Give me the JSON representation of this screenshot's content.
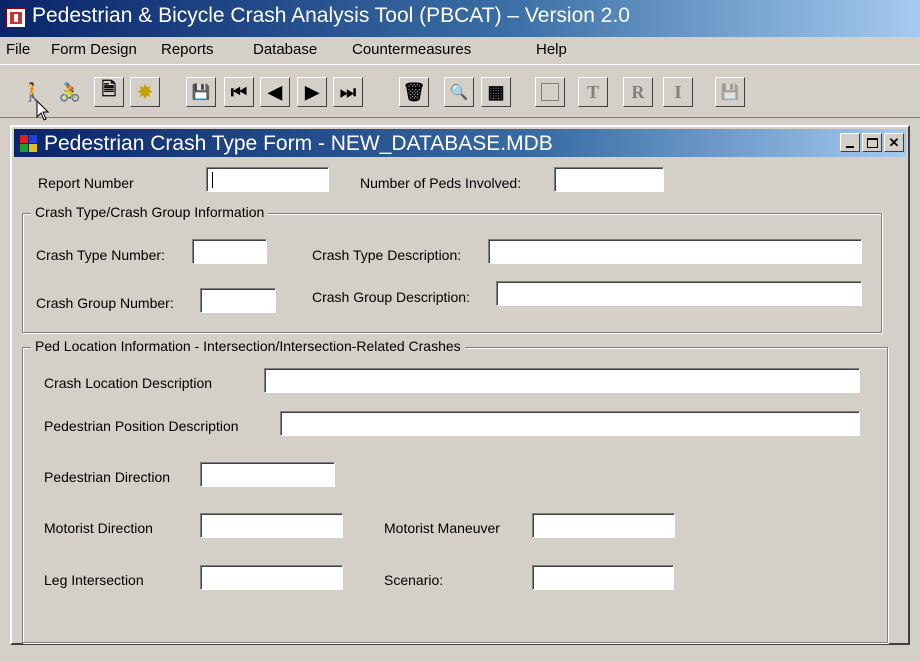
{
  "app": {
    "title": "Pedestrian & Bicycle Crash Analysis Tool (PBCAT) – Version 2.0"
  },
  "menu": [
    "File",
    "Form Design",
    "Reports",
    "Database",
    "Countermeasures",
    "Help"
  ],
  "toolbar": [
    {
      "name": "pedestrian-icon",
      "glyph": "🚶",
      "enabled": true
    },
    {
      "name": "bicycle-icon",
      "glyph": "🚴",
      "enabled": true
    },
    {
      "name": "properties-icon",
      "glyph": "🗎",
      "enabled": true
    },
    {
      "name": "new-record-icon",
      "glyph": "✸",
      "enabled": true
    },
    {
      "name": "save-icon",
      "glyph": "💾",
      "enabled": true
    },
    {
      "name": "first-record-icon",
      "glyph": "⏮",
      "enabled": true
    },
    {
      "name": "previous-record-icon",
      "glyph": "◀",
      "enabled": true
    },
    {
      "name": "next-record-icon",
      "glyph": "▶",
      "enabled": true
    },
    {
      "name": "last-record-icon",
      "glyph": "⏭",
      "enabled": true
    },
    {
      "name": "delete-icon",
      "glyph": "🗑",
      "enabled": true
    },
    {
      "name": "search-icon",
      "glyph": "🔍",
      "enabled": true
    },
    {
      "name": "calculator-icon",
      "glyph": "▦",
      "enabled": true
    },
    {
      "name": "blank-icon",
      "glyph": "",
      "enabled": false
    },
    {
      "name": "text-t-icon",
      "glyph": "T",
      "enabled": false
    },
    {
      "name": "text-r-icon",
      "glyph": "R",
      "enabled": false
    },
    {
      "name": "text-i-icon",
      "glyph": "I",
      "enabled": false
    },
    {
      "name": "save-disabled-icon",
      "glyph": "💾",
      "enabled": false
    }
  ],
  "form": {
    "title": "Pedestrian Crash Type Form - NEW_DATABASE.MDB",
    "report_number_label": "Report Number",
    "report_number_value": "",
    "num_peds_label": "Number of Peds Involved:",
    "num_peds_value": "",
    "crash_group": {
      "legend": "Crash Type/Crash Group Information",
      "crash_type_number_label": "Crash Type Number:",
      "crash_type_number_value": "",
      "crash_type_desc_label": "Crash Type Description:",
      "crash_type_desc_value": "",
      "crash_group_number_label": "Crash Group Number:",
      "crash_group_number_value": "",
      "crash_group_desc_label": "Crash Group Description:",
      "crash_group_desc_value": ""
    },
    "ped_location": {
      "legend": "Ped Location Information - Intersection/Intersection-Related Crashes",
      "crash_location_label": "Crash Location Description",
      "crash_location_value": "",
      "ped_position_label": "Pedestrian Position Description",
      "ped_position_value": "",
      "ped_direction_label": "Pedestrian Direction",
      "ped_direction_value": "",
      "motorist_direction_label": "Motorist Direction",
      "motorist_direction_value": "",
      "motorist_maneuver_label": "Motorist Maneuver",
      "motorist_maneuver_value": "",
      "leg_intersection_label": "Leg Intersection",
      "leg_intersection_value": "",
      "scenario_label": "Scenario:",
      "scenario_value": ""
    }
  }
}
